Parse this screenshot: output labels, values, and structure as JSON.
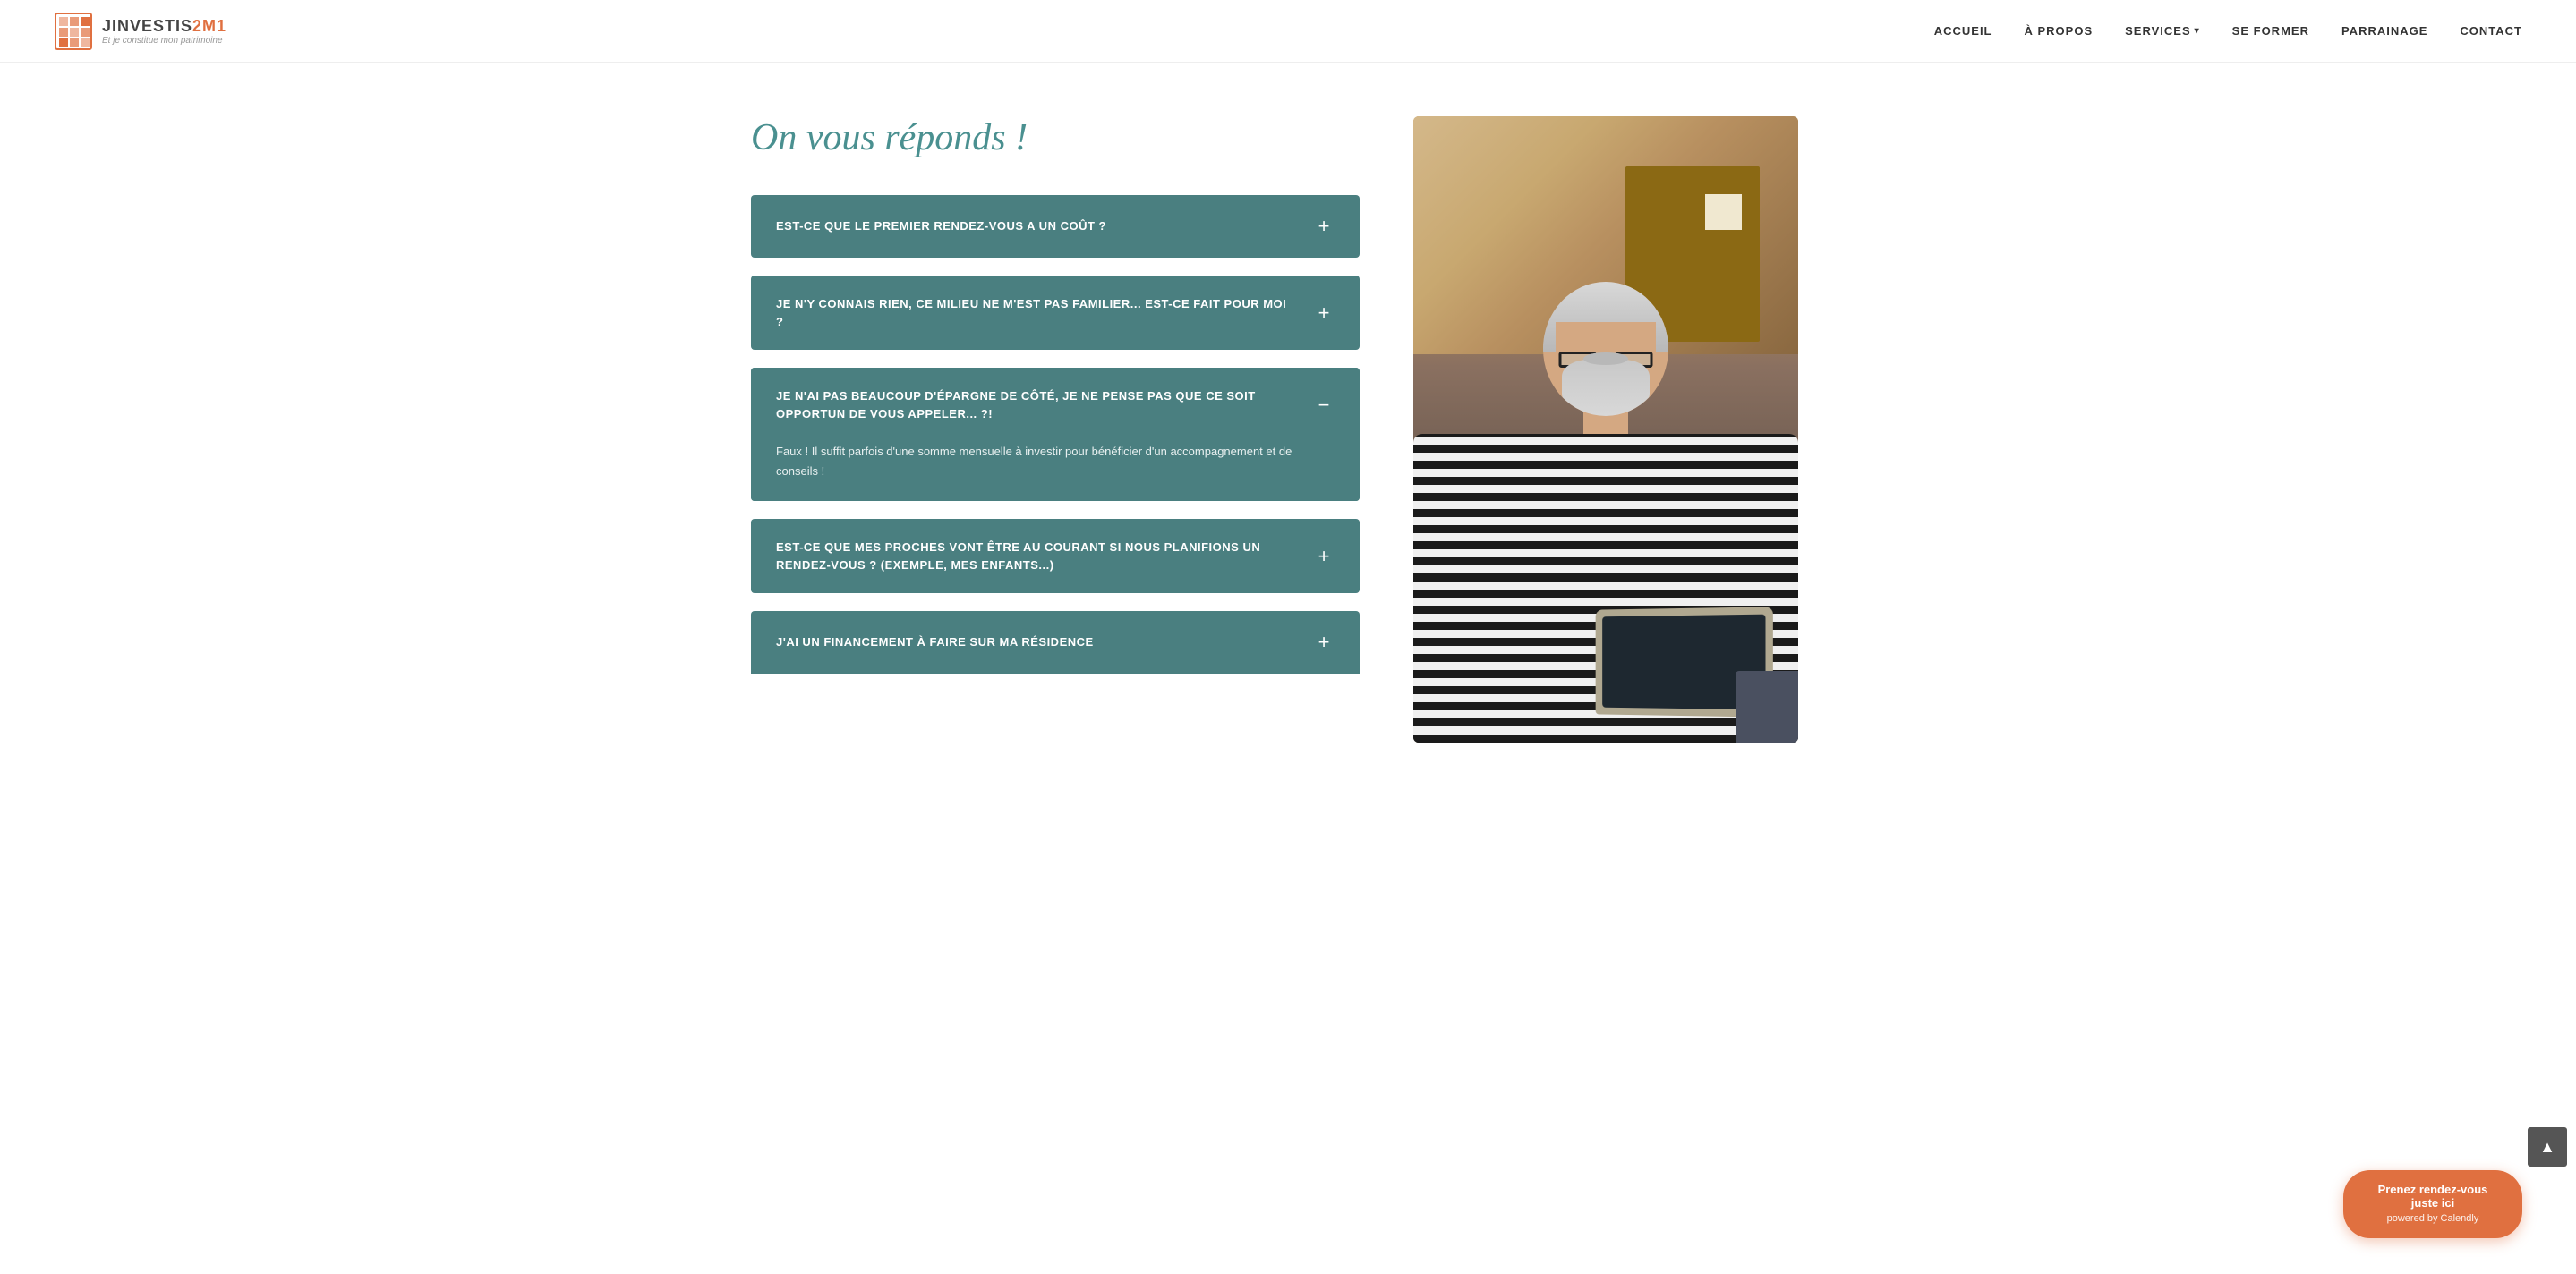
{
  "header": {
    "logo": {
      "main_text": "JINVESTIS",
      "main_text_colored": "2M1",
      "subtitle": "Et je constitue mon patrimoine"
    },
    "nav": {
      "items": [
        {
          "id": "accueil",
          "label": "ACCUEIL"
        },
        {
          "id": "a-propos",
          "label": "À PROPOS"
        },
        {
          "id": "services",
          "label": "SERVICES",
          "has_dropdown": true
        },
        {
          "id": "se-former",
          "label": "SE FORMER"
        },
        {
          "id": "parrainage",
          "label": "PARRAINAGE"
        },
        {
          "id": "contact",
          "label": "CONTACT"
        }
      ]
    }
  },
  "main": {
    "faq_title": "On vous réponds !",
    "faq_items": [
      {
        "id": "faq-1",
        "question": "EST-CE QUE LE PREMIER RENDEZ-VOUS A UN COÛT ?",
        "answer": "",
        "open": false,
        "toggle_symbol_open": "−",
        "toggle_symbol_closed": "+"
      },
      {
        "id": "faq-2",
        "question": "JE N'Y CONNAIS RIEN, CE MILIEU NE M'EST PAS FAMILIER... EST-CE FAIT POUR MOI ?",
        "answer": "",
        "open": false,
        "toggle_symbol_open": "−",
        "toggle_symbol_closed": "+"
      },
      {
        "id": "faq-3",
        "question": "JE N'AI PAS BEAUCOUP D'ÉPARGNE DE CÔTÉ, JE NE PENSE PAS QUE CE SOIT OPPORTUN DE VOUS APPELER... ?!",
        "answer": "Faux ! Il suffit parfois d'une somme mensuelle à investir pour bénéficier d'un accompagnement et de conseils !",
        "open": true,
        "toggle_symbol_open": "−",
        "toggle_symbol_closed": "+"
      },
      {
        "id": "faq-4",
        "question": "EST-CE QUE MES PROCHES VONT ÊTRE AU COURANT SI NOUS PLANIFIONS UN RENDEZ-VOUS ? (EXEMPLE, MES ENFANTS...)",
        "answer": "",
        "open": false,
        "toggle_symbol_open": "−",
        "toggle_symbol_closed": "+"
      },
      {
        "id": "faq-5",
        "question": "J'AI UN FINANCEMENT À FAIRE SUR MA RÉSIDENCE",
        "answer": "",
        "open": false,
        "toggle_symbol_open": "−",
        "toggle_symbol_closed": "+"
      }
    ]
  },
  "calendly_cta": {
    "main_label": "Prenez rendez-vous juste ici",
    "sub_label": "powered by Calendly"
  },
  "scroll_top": {
    "icon": "▲"
  }
}
